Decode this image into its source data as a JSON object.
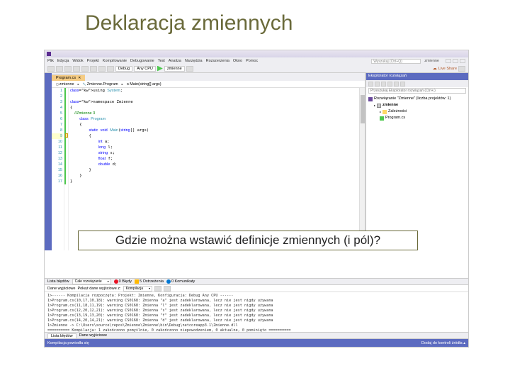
{
  "slide": {
    "title": "Deklaracja zmiennych",
    "callout": "Gdzie można wstawić definicje zmiennych (i pól)?"
  },
  "menubar": {
    "items": [
      "Plik",
      "Edycja",
      "Widok",
      "Projekt",
      "Kompilowanie",
      "Debugowanie",
      "Test",
      "Analiza",
      "Narzędzia",
      "Rozszerzenia",
      "Okno",
      "Pomoc"
    ],
    "search_placeholder": "Wyszukaj (Ctrl+Q)",
    "solution_name": "zmienne"
  },
  "toolbar": {
    "config": "Debug",
    "platform": "Any CPU",
    "run_label": "zmienne",
    "login": "Live Share"
  },
  "tab": {
    "name": "Program.cs",
    "dirty": "✕"
  },
  "breadcrumb": {
    "items": [
      "zmienne",
      "Zmienne.Program",
      "Main(string[] args)"
    ]
  },
  "gutter": {
    "from": 1,
    "to": 17,
    "highlight": 9
  },
  "code": {
    "l1": "using System;",
    "l3": "namespace Zmienne",
    "l4": "{",
    "l5": "    //Zmienne 3",
    "l6": "    class Program",
    "l7": "    {",
    "l8": "        static void Main(string[] args)",
    "l9": "        {",
    "l10": "            int a;",
    "l11": "            long l;",
    "l12": "            string s;",
    "l13": "            float f;",
    "l14": "            double d;",
    "l15": "        }",
    "l16": "    }",
    "l17": "}"
  },
  "explorer": {
    "title": "Eksplorator rozwiązań",
    "search_placeholder": "Przeszukaj Eksplorator rozwiązań (Ctrl+;)",
    "solution": "Rozwiązanie \"Zmienne\" (liczba projektów: 1)",
    "project": "zmienne",
    "deps": "Zależności",
    "file": "Program.cs"
  },
  "errors": {
    "panel_title": "Lista błędów",
    "scope": "Całe rozwiązanie",
    "err": "0",
    "err_label": "0 Błędy",
    "warn": "5",
    "warn_label": "5 Ostrzeżenia",
    "msg": "0",
    "msg_label": "0 Komunikaty"
  },
  "output": {
    "title": "Dane wyjściowe",
    "source_label": "Pokaż dane wyjściowe z:",
    "source": "Kompilacja",
    "lines": [
      "1>------ Kompilacja rozpoczęta: Projekt: Zmienne, Konfiguracja: Debug Any CPU ------",
      "1>Program.cs(10,17,10,18): warning CS0168: Zmienna \"a\" jest zadeklarowana, lecz nie jest nigdy używana",
      "1>Program.cs(11,18,11,19): warning CS0168: Zmienna \"l\" jest zadeklarowana, lecz nie jest nigdy używana",
      "1>Program.cs(12,20,12,21): warning CS0168: Zmienna \"s\" jest zadeklarowana, lecz nie jest nigdy używana",
      "1>Program.cs(13,19,13,20): warning CS0168: Zmienna \"f\" jest zadeklarowana, lecz nie jest nigdy używana",
      "1>Program.cs(14,20,14,21): warning CS0168: Zmienna \"d\" jest zadeklarowana, lecz nie jest nigdy używana",
      "1>Zmienne -> C:\\Users\\source\\repos\\Zmienne\\Zmienne\\bin\\Debug\\netcoreapp3.1\\Zmienne.dll",
      "========== Kompilacja: 1 zakończono pomyślnie, 0 zakończono niepowodzeniem, 0 aktualne, 0 pominięto =========="
    ]
  },
  "statusbar": {
    "left": "Kompilacja powiodła się",
    "right": "Dodaj do kontroli źródła ▴"
  },
  "bottom_tabs": {
    "list": "Lista błędów",
    "output": "Dane wyjściowe"
  }
}
